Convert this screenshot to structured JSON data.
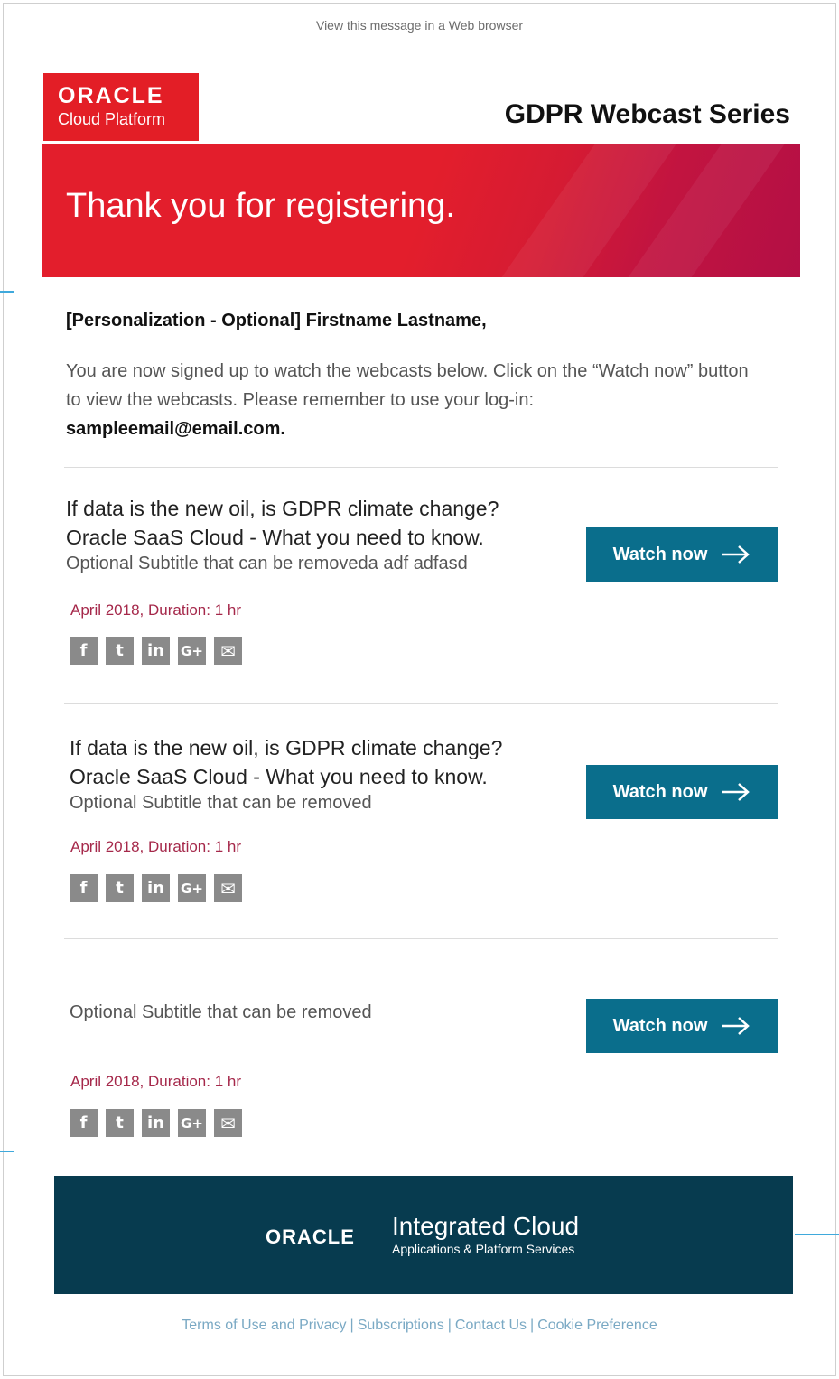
{
  "header": {
    "view_link": "View this message in a Web browser",
    "logo_wordmark": "ORACLE",
    "logo_sub": "Cloud Platform",
    "series_title": "GDPR Webcast Series"
  },
  "hero": {
    "text": "Thank you for registering."
  },
  "greeting": "[Personalization - Optional] Firstname Lastname,",
  "intro": {
    "text": "You are now signed up to watch the webcasts below. Click on the “Watch now” button to view the webcasts. Please remember to use your log-in:",
    "email": "sampleemail@email.com."
  },
  "webcasts": [
    {
      "title1": "If data is the new oil, is GDPR climate change?",
      "title2": "Oracle SaaS Cloud - What you need to know.",
      "subtitle": "Optional Subtitle that can be removeda adf adfasd",
      "date": "April 2018, Duration: 1 hr",
      "button": "Watch now"
    },
    {
      "title1": "If data is the new oil, is GDPR climate change?",
      "title2": "Oracle SaaS Cloud - What you need to know.",
      "subtitle": "Optional Subtitle that can be removed",
      "date": "April 2018, Duration: 1 hr",
      "button": "Watch now"
    },
    {
      "subtitle": "Optional Subtitle that can be removed",
      "date": "April 2018, Duration: 1 hr",
      "button": "Watch now"
    }
  ],
  "social_icons": [
    "facebook-icon",
    "twitter-icon",
    "linkedin-icon",
    "google-plus-icon",
    "email-icon"
  ],
  "footer": {
    "wordmark": "ORACLE",
    "product": "Integrated Cloud",
    "product_sub": "Applications & Platform Services",
    "links": [
      "Terms of Use and Privacy",
      "Subscriptions",
      "Contact Us",
      "Cookie Preference"
    ]
  },
  "colors": {
    "oracle_red": "#e31e26",
    "button_teal": "#0a6e8c",
    "footer_navy": "#073b4f",
    "date_red": "#a5284a",
    "link_blue": "#7aa9c4"
  }
}
